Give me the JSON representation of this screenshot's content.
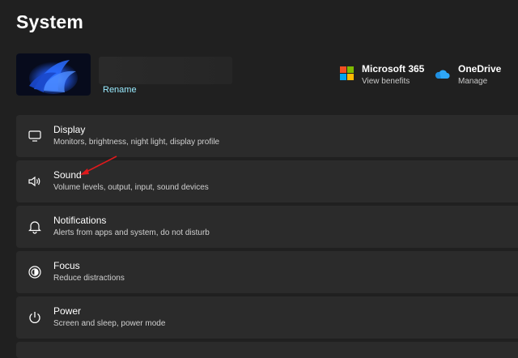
{
  "page": {
    "title": "System"
  },
  "device": {
    "rename_label": "Rename"
  },
  "header_cards": [
    {
      "title": "Microsoft 365",
      "subtitle": "View benefits",
      "icon": "microsoft-logo-icon"
    },
    {
      "title": "OneDrive",
      "subtitle": "Manage",
      "icon": "onedrive-cloud-icon"
    }
  ],
  "settings": [
    {
      "label": "Display",
      "description": "Monitors, brightness, night light, display profile",
      "icon": "monitor-icon"
    },
    {
      "label": "Sound",
      "description": "Volume levels, output, input, sound devices",
      "icon": "speaker-icon"
    },
    {
      "label": "Notifications",
      "description": "Alerts from apps and system, do not disturb",
      "icon": "bell-icon"
    },
    {
      "label": "Focus",
      "description": "Reduce distractions",
      "icon": "focus-icon"
    },
    {
      "label": "Power",
      "description": "Screen and sleep, power mode",
      "icon": "power-icon"
    }
  ],
  "colors": {
    "background": "#202020",
    "card": "#2b2b2b",
    "link": "#99ebff",
    "annotation_arrow": "#e0191c",
    "ms_red": "#f25022",
    "ms_green": "#7fba00",
    "ms_blue": "#00a4ef",
    "ms_yellow": "#ffb900",
    "onedrive_blue": "#1f8fe0"
  }
}
